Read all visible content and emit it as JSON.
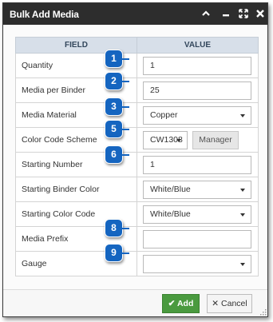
{
  "window": {
    "title": "Bulk Add Media"
  },
  "table": {
    "headers": {
      "field": "FIELD",
      "value": "VALUE"
    },
    "rows": [
      {
        "label": "Quantity",
        "type": "text",
        "value": "1"
      },
      {
        "label": "Media per Binder",
        "type": "text",
        "value": "25"
      },
      {
        "label": "Media Material",
        "type": "select",
        "value": "Copper"
      },
      {
        "label": "Color Code Scheme",
        "type": "select-button",
        "value": "CW1308",
        "button": "Manager"
      },
      {
        "label": "Starting Number",
        "type": "text",
        "value": "1"
      },
      {
        "label": "Starting Binder Color",
        "type": "select",
        "value": "White/Blue"
      },
      {
        "label": "Starting Color Code",
        "type": "select",
        "value": "White/Blue"
      },
      {
        "label": "Media Prefix",
        "type": "text",
        "value": ""
      },
      {
        "label": "Gauge",
        "type": "select",
        "value": ""
      }
    ]
  },
  "callouts": [
    "1",
    "2",
    "3",
    "5",
    "6",
    "8",
    "9"
  ],
  "footer": {
    "add_label": "Add",
    "cancel_label": "Cancel"
  },
  "colors": {
    "title_bar": "#2d2d2d",
    "callout": "#1565c0",
    "add_button": "#4a9a3f",
    "header": "#d7dfe9"
  }
}
